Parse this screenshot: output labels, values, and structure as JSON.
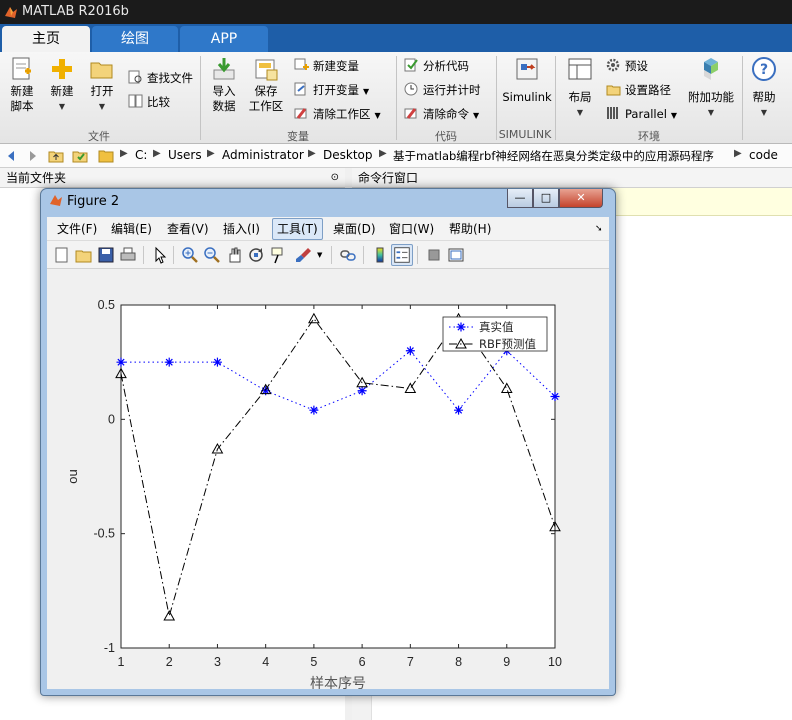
{
  "app": {
    "title": "MATLAB R2016b",
    "tabs": [
      {
        "label": "主页",
        "active": true
      },
      {
        "label": "绘图",
        "active": false
      },
      {
        "label": "APP",
        "active": false
      }
    ]
  },
  "ribbon": {
    "file": {
      "group": "文件",
      "new_script": [
        "新建",
        "脚本"
      ],
      "new": "新建",
      "open": "打开",
      "find_files": "查找文件",
      "compare": "比较"
    },
    "variable": {
      "group": "变量",
      "import": [
        "导入",
        "数据"
      ],
      "save_ws": [
        "保存",
        "工作区"
      ],
      "new_var": "新建变量",
      "open_var": "打开变量",
      "clear_ws": "清除工作区"
    },
    "code": {
      "group": "代码",
      "analyze": "分析代码",
      "run_time": "运行并计时",
      "clear_cmd": "清除命令"
    },
    "simulink": {
      "group": "SIMULINK",
      "label": "Simulink"
    },
    "env": {
      "group": "环境",
      "layout": "布局",
      "prefs": "预设",
      "set_path": "设置路径",
      "parallel": "Parallel",
      "addons": "附加功能"
    },
    "help": "帮助"
  },
  "address": {
    "crumbs": [
      "C:",
      "Users",
      "Administrator",
      "Desktop",
      "基于matlab编程rbf神经网络在恶臭分类定级中的应用源码程序",
      "code"
    ]
  },
  "panels": {
    "current_folder": "当前文件夹",
    "command_window": "命令行窗口"
  },
  "figure": {
    "title": "Figure 2",
    "menu": [
      "文件(F)",
      "编辑(E)",
      "查看(V)",
      "插入(I)",
      "工具(T)",
      "桌面(D)",
      "窗口(W)",
      "帮助(H)"
    ],
    "active_menu": "工具(T)",
    "buttons": {
      "minimize": "—",
      "maximize": "□",
      "close": "✕"
    },
    "toolbar_icons": [
      "new-figure-icon",
      "open-file-icon",
      "save-icon",
      "print-icon",
      "edit-plot-arrow-icon",
      "zoom-in-icon",
      "zoom-out-icon",
      "pan-hand-icon",
      "rotate-3d-icon",
      "data-cursor-icon",
      "brush-icon",
      "link-plot-icon",
      "colorbar-icon",
      "legend-icon",
      "hide-plot-tools-icon",
      "show-plot-tools-icon"
    ]
  },
  "chart_data": {
    "type": "line",
    "title": "",
    "xlabel": "样本序号",
    "ylabel": "ou",
    "xlim": [
      1,
      10
    ],
    "ylim": [
      -1,
      0.5
    ],
    "xticks": [
      1,
      2,
      3,
      4,
      5,
      6,
      7,
      8,
      9,
      10
    ],
    "yticks": [
      -1,
      -0.5,
      0,
      0.5
    ],
    "ytick_labels": [
      "-1",
      "-0.5",
      "0",
      "0.5"
    ],
    "grid": false,
    "legend_position": "top-right",
    "x": [
      1,
      2,
      3,
      4,
      5,
      6,
      7,
      8,
      9,
      10
    ],
    "series": [
      {
        "name": "真实值",
        "values": [
          0.25,
          0.25,
          0.25,
          0.125,
          0.04,
          0.125,
          0.3,
          0.04,
          0.3,
          0.1
        ],
        "color": "#0000ff",
        "line": "dotted",
        "marker": "asterisk"
      },
      {
        "name": "RBF预测值",
        "values": [
          0.2,
          -0.86,
          -0.13,
          0.13,
          0.44,
          0.16,
          0.135,
          0.44,
          0.135,
          -0.47
        ],
        "color": "#000000",
        "line": "dashdot",
        "marker": "triangle"
      }
    ]
  },
  "colors": {
    "tab_bar": "#1e5ea8",
    "blue_series": "#0000ff",
    "black_series": "#000000",
    "window_frame": "#a9c6e6"
  }
}
